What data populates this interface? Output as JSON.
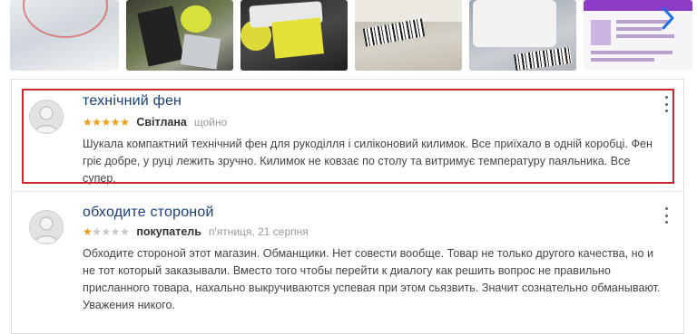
{
  "gallery": {
    "next_arrow_icon": "chevron-right-icon",
    "accent": "#1e6fe0"
  },
  "reviews": [
    {
      "title": "технічний фен",
      "rating": 5,
      "rating_max": 5,
      "author": "Світлана",
      "date": "щойно",
      "text": "Шукала компактний технічний фен для рукоділля і силіконовий килимок. Все приїхало в одній коробці. Фен гріє добре, у руці лежить зручно. Килимок не ковзає по столу та витримує температуру паяльника. Все супер.",
      "highlighted": true
    },
    {
      "title": "обходите стороной",
      "rating": 1,
      "rating_max": 5,
      "author": "покупатель",
      "date": "п'ятниця, 21 серпня",
      "text": "Обходите стороной этот магазин. Обманщики. Нет совести вообще. Товар не только другого качества, но и не тот который заказывали. Вместо того чтобы перейти к диалогу как решить вопрос не правильно присланного товара, нахально выкручиваются успевая при этом сьязвить. Значит сознательно обманывают. Уважения никого.",
      "highlighted": false
    }
  ],
  "colors": {
    "title": "#1a3e7a",
    "star_on": "#f29a12",
    "star_off": "#c8c8c8",
    "highlight_border": "#d0252f"
  }
}
